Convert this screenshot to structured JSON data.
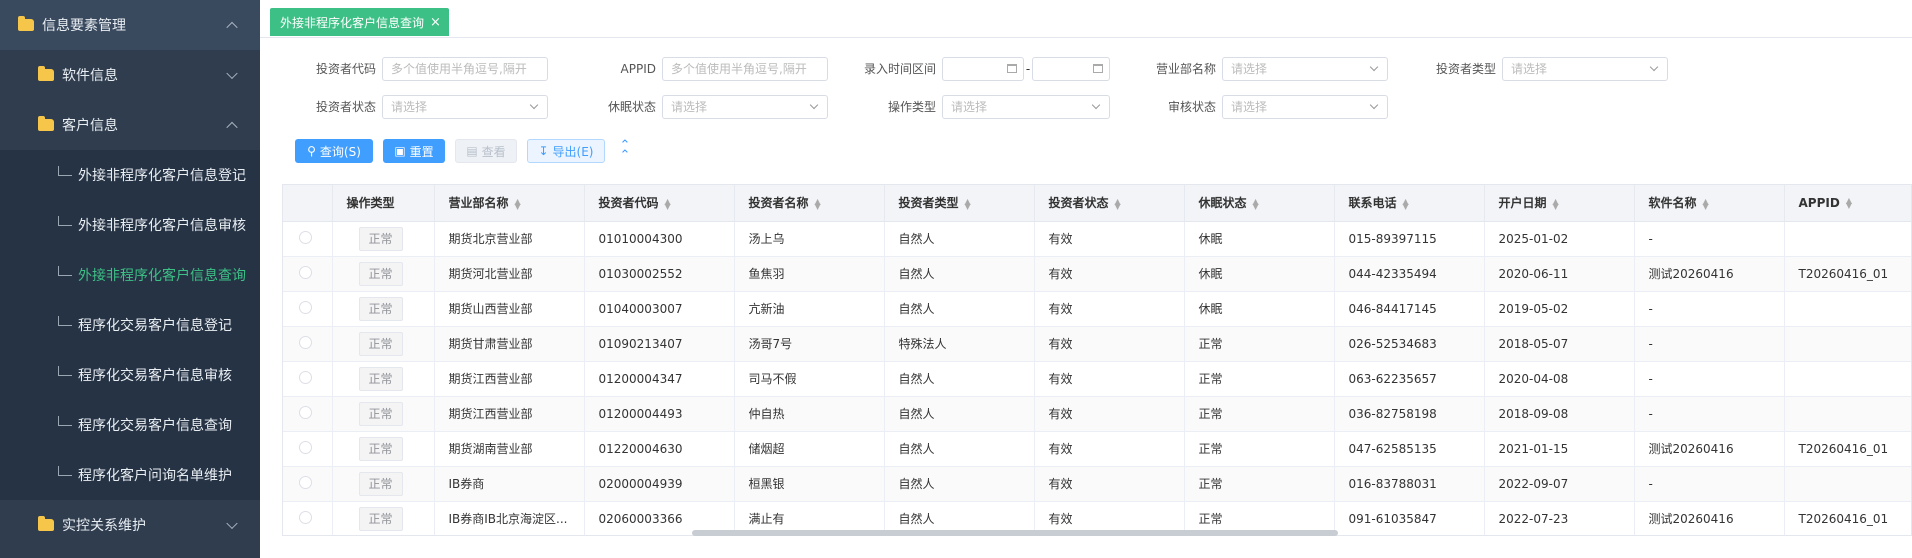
{
  "sidebar": {
    "items": [
      {
        "label": "信息要素管理",
        "icon": "folder-icon"
      },
      {
        "label": "软件信息",
        "icon": "folder-icon"
      },
      {
        "label": "客户信息",
        "icon": "folder-icon"
      },
      {
        "label": "外接非程序化客户信息登记"
      },
      {
        "label": "外接非程序化客户信息审核"
      },
      {
        "label": "外接非程序化客户信息查询"
      },
      {
        "label": "程序化交易客户信息登记"
      },
      {
        "label": "程序化交易客户信息审核"
      },
      {
        "label": "程序化交易客户信息查询"
      },
      {
        "label": "程序化客户问询名单维护"
      },
      {
        "label": "实控关系维护",
        "icon": "folder-icon"
      }
    ],
    "accent": "#3dc086"
  },
  "tab": {
    "label": "外接非程序化客户信息查询",
    "close": "×"
  },
  "filters": {
    "investor_code": {
      "label": "投资者代码",
      "placeholder": "多个值使用半角逗号,隔开"
    },
    "appid": {
      "label": "APPID",
      "placeholder": "多个值使用半角逗号,隔开"
    },
    "entry_time": {
      "label": "录入时间区间",
      "separator": "-"
    },
    "branch": {
      "label": "营业部名称",
      "placeholder": "请选择"
    },
    "investor_type": {
      "label": "投资者类型",
      "placeholder": "请选择"
    },
    "investor_status": {
      "label": "投资者状态",
      "placeholder": "请选择"
    },
    "dormant_status": {
      "label": "休眠状态",
      "placeholder": "请选择"
    },
    "operation_type": {
      "label": "操作类型",
      "placeholder": "请选择"
    },
    "review_status": {
      "label": "审核状态",
      "placeholder": "请选择"
    }
  },
  "buttons": {
    "query": "查询(S)",
    "reset": "重置",
    "view": "查看",
    "export": "导出(E)"
  },
  "table": {
    "columns": [
      "",
      "操作类型",
      "营业部名称",
      "投资者代码",
      "投资者名称",
      "投资者类型",
      "投资者状态",
      "休眠状态",
      "联系电话",
      "开户日期",
      "软件名称",
      "APPID"
    ],
    "rows": [
      [
        "正常",
        "期货北京营业部",
        "01010004300",
        "汤上乌",
        "自然人",
        "有效",
        "休眠",
        "015-89397115",
        "2025-01-02",
        "-",
        ""
      ],
      [
        "正常",
        "期货河北营业部",
        "01030002552",
        "鱼焦羽",
        "自然人",
        "有效",
        "休眠",
        "044-42335494",
        "2020-06-11",
        "测试20260416",
        "T20260416_01"
      ],
      [
        "正常",
        "期货山西营业部",
        "01040003007",
        "亢新油",
        "自然人",
        "有效",
        "休眠",
        "046-84417145",
        "2019-05-02",
        "-",
        ""
      ],
      [
        "正常",
        "期货甘肃营业部",
        "01090213407",
        "汤哥7号",
        "特殊法人",
        "有效",
        "正常",
        "026-52534683",
        "2018-05-07",
        "-",
        ""
      ],
      [
        "正常",
        "期货江西营业部",
        "01200004347",
        "司马不假",
        "自然人",
        "有效",
        "正常",
        "063-62235657",
        "2020-04-08",
        "-",
        ""
      ],
      [
        "正常",
        "期货江西营业部",
        "01200004493",
        "仲自热",
        "自然人",
        "有效",
        "正常",
        "036-82758198",
        "2018-09-08",
        "-",
        ""
      ],
      [
        "正常",
        "期货湖南营业部",
        "01220004630",
        "储烟超",
        "自然人",
        "有效",
        "正常",
        "047-62585135",
        "2021-01-15",
        "测试20260416",
        "T20260416_01"
      ],
      [
        "正常",
        "IB券商",
        "02000004939",
        "桓黑银",
        "自然人",
        "有效",
        "正常",
        "016-83788031",
        "2022-09-07",
        "-",
        ""
      ],
      [
        "正常",
        "IB券商IB北京海淀区...",
        "02060003366",
        "满止有",
        "自然人",
        "有效",
        "正常",
        "091-61035847",
        "2022-07-23",
        "测试20260416",
        "T20260416_01"
      ]
    ]
  }
}
